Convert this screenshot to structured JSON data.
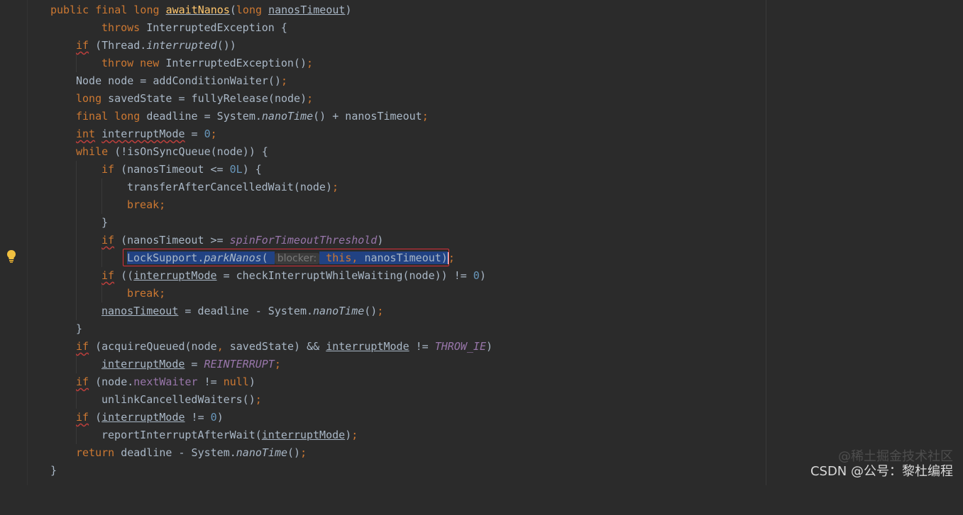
{
  "editor": {
    "lines": [
      "public final long awaitNanos(long nanosTimeout)",
      "throws InterruptedException {",
      "if (Thread.interrupted())",
      "throw new InterruptedException();",
      "Node node = addConditionWaiter();",
      "long savedState = fullyRelease(node);",
      "final long deadline = System.nanoTime() + nanosTimeout;",
      "int interruptMode = 0;",
      "while (!isOnSyncQueue(node)) {",
      "if (nanosTimeout <= 0L) {",
      "transferAfterCancelledWait(node);",
      "break;",
      "}",
      "if (nanosTimeout >= spinForTimeoutThreshold)",
      "LockSupport.parkNanos( blocker: this, nanosTimeout);",
      "if ((interruptMode = checkInterruptWhileWaiting(node)) != 0)",
      "break;",
      "nanosTimeout = deadline - System.nanoTime();",
      "}",
      "if (acquireQueued(node, savedState) && interruptMode != THROW_IE)",
      "interruptMode = REINTERRUPT;",
      "if (node.nextWaiter != null)",
      "unlinkCancelledWaiters();",
      "if (interruptMode != 0)",
      "reportInterruptAfterWait(interruptMode);",
      "return deadline - System.nanoTime();",
      "}"
    ],
    "hint_label": "blocker:",
    "highlighted_line": 15,
    "colors": {
      "background": "#2b2b2b",
      "keyword": "#cc7832",
      "method_decl": "#ffc66d",
      "number": "#6897bb",
      "constant": "#9876aa",
      "selection": "#214283",
      "highlight_box": "#d9313a"
    },
    "gutter_icon": "lightbulb-icon"
  },
  "watermark": {
    "line1": "@稀土掘金技术社区",
    "line2": "CSDN @公号：黎杜编程"
  }
}
